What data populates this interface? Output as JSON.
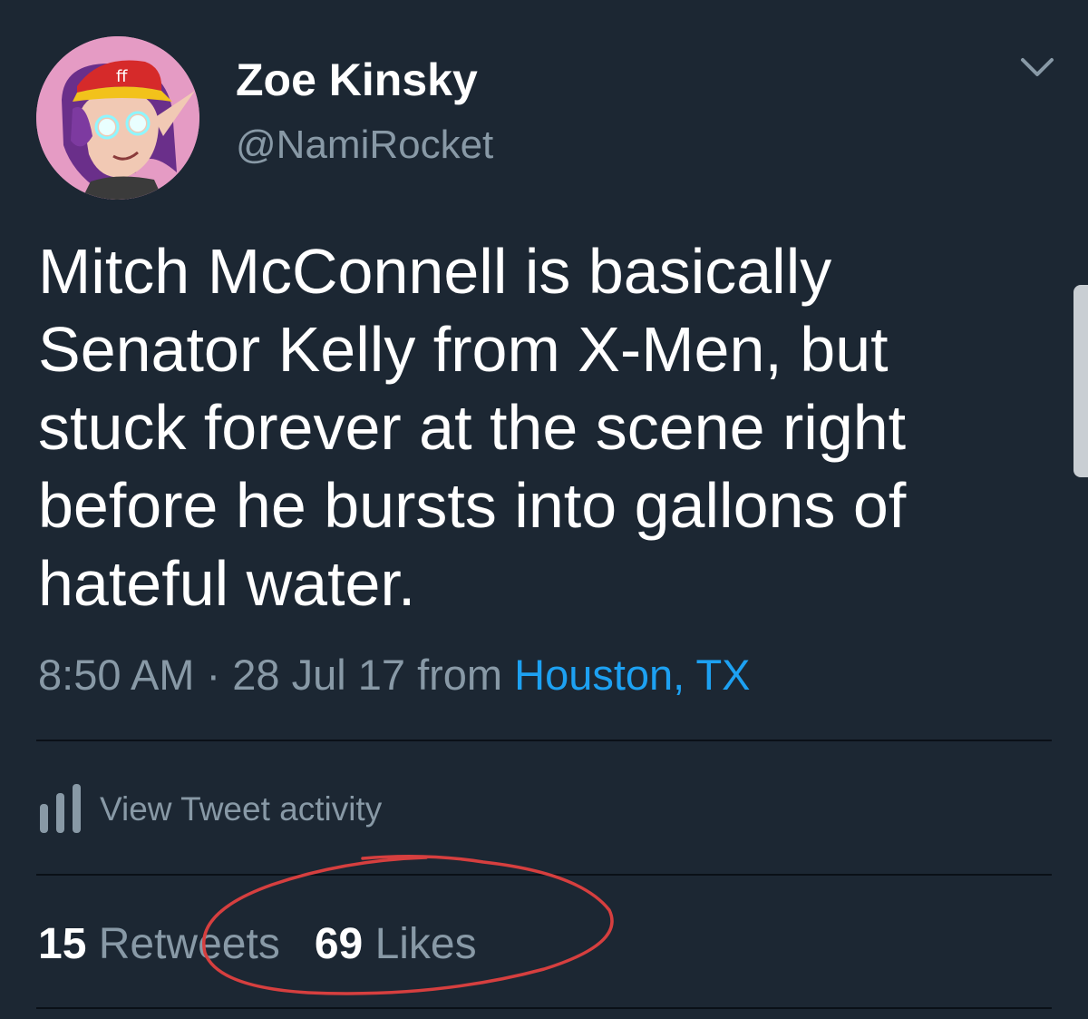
{
  "user": {
    "display_name": "Zoe Kinsky",
    "handle": "@NamiRocket"
  },
  "tweet": {
    "text": "Mitch McConnell is basically Senator Kelly from X-Men, but stuck forever at the scene right before he bursts into gallons of hateful water.",
    "time": "8:50 AM",
    "separator": "·",
    "date": "28 Jul 17",
    "from_label": "from",
    "location": "Houston, TX"
  },
  "activity": {
    "label": "View Tweet activity",
    "icon": "bar-chart-icon"
  },
  "stats": {
    "retweets_count": "15",
    "retweets_label": "Retweets",
    "likes_count": "69",
    "likes_label": "Likes"
  },
  "icons": {
    "menu": "chevron-down-icon",
    "annotation": "red-hand-drawn-circle"
  },
  "colors": {
    "background": "#1c2733",
    "primary_text": "#ffffff",
    "secondary_text": "#8899a6",
    "link": "#1da1f2",
    "annotation": "#d63f3f"
  }
}
